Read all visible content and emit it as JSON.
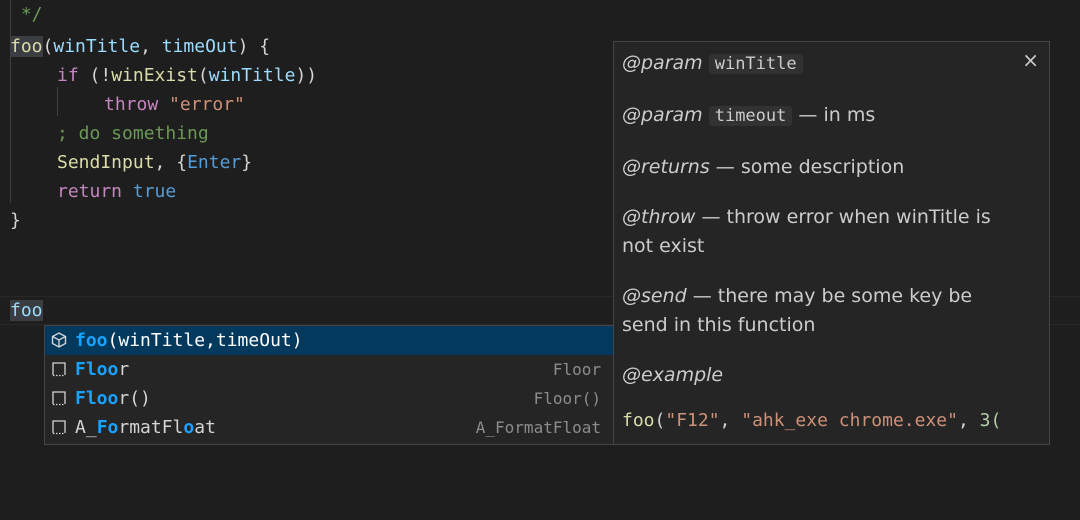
{
  "editor": {
    "top_comment": " */",
    "lines": {
      "l1": {
        "fn": "foo",
        "p1": "(",
        "a1": "winTitle",
        "p2": ", ",
        "a2": "timeOut",
        "p3": ") {"
      },
      "l2": {
        "kw": "if",
        "p1": " (!",
        "fn": "winExist",
        "p2": "(",
        "var": "winTitle",
        "p3": "))"
      },
      "l3": {
        "kw": "throw",
        "sp": " ",
        "str": "\"error\""
      },
      "l4": {
        "comment": "; do something"
      },
      "l5": {
        "fn": "SendInput",
        "p1": ", {",
        "con": "Enter",
        "p2": "}"
      },
      "l6": {
        "kw": "return",
        "sp": " ",
        "con": "true"
      },
      "l7": {
        "brace": "}"
      },
      "l9": {
        "typed": "foo"
      }
    }
  },
  "suggest": {
    "items": [
      {
        "match": "foo",
        "rest": "(winTitle,timeOut)",
        "detail": "",
        "icon": "cube-icon",
        "selected": true
      },
      {
        "m1": "F",
        "r1": "",
        "m2": "loo",
        "r2": "r",
        "detail": "Floor",
        "icon": "snippet-icon"
      },
      {
        "m1": "F",
        "r1": "",
        "m2": "loo",
        "r2": "r()",
        "detail": "Floor()",
        "icon": "snippet-icon"
      },
      {
        "p0": "A_",
        "m1": "Fo",
        "p1": "rmatFl",
        "m2": "o",
        "p2": "at",
        "detail": "A_FormatFloat",
        "icon": "snippet-icon"
      }
    ]
  },
  "doc": {
    "close": "×",
    "param1_tag": "@param",
    "param1_name": "winTitle",
    "param2_tag": "@param",
    "param2_name": "timeout",
    "param2_desc": " — in ms",
    "returns_tag": "@returns",
    "returns_desc": " — some description",
    "throw_tag": "@throw",
    "throw_desc": " — throw error when winTitle is not exist",
    "send_tag": "@send",
    "send_desc": " — there may be some key be send in this function",
    "example_tag": "@example",
    "example_fn": "foo",
    "example_p1": "(",
    "example_s1": "\"F12\"",
    "example_p2": ", ",
    "example_s2": "\"ahk_exe chrome.exe\"",
    "example_p3": ", ",
    "example_n": "3("
  },
  "colors": {
    "background": "#1e1e1e",
    "keyword": "#c586c0",
    "string": "#ce9178",
    "function": "#dcdcaa",
    "variable": "#9cdcfe",
    "comment": "#6a9955",
    "constant": "#569cd6",
    "match_highlight": "#18a3ff",
    "selection": "#04395e"
  }
}
